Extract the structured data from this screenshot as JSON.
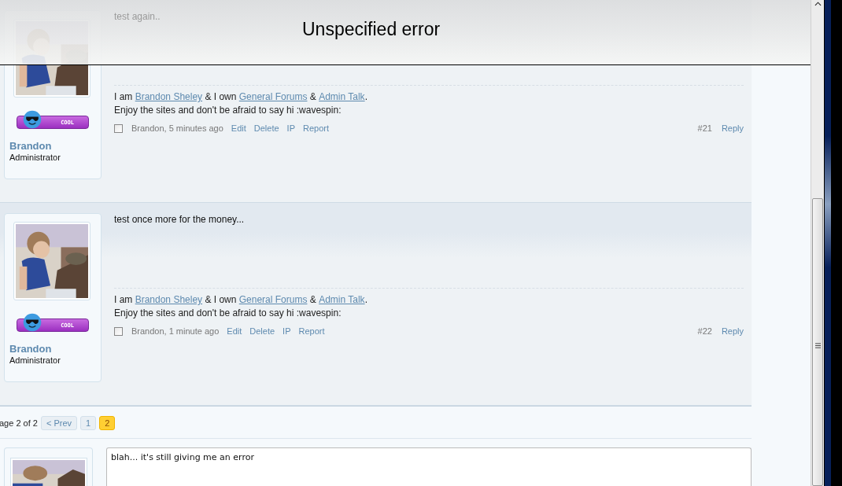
{
  "error_banner": {
    "title": "Unspecified error"
  },
  "posts": [
    {
      "message": "test again..",
      "author": "Brandon",
      "role": "Administrator",
      "badge": "COOL",
      "signature": [
        [
          {
            "kind": "text",
            "text": "I am "
          },
          {
            "kind": "link",
            "text": "Brandon Sheley"
          },
          {
            "kind": "text",
            "text": " & I own "
          },
          {
            "kind": "link",
            "text": "General Forums"
          },
          {
            "kind": "text",
            "text": " & "
          },
          {
            "kind": "link",
            "text": "Admin Talk"
          },
          {
            "kind": "text",
            "text": "."
          }
        ],
        [
          {
            "kind": "text",
            "text": "Enjoy the sites and don't be afraid to say hi :wavespin:"
          }
        ]
      ],
      "meta": "Brandon, 5 minutes ago",
      "actions": [
        "Edit",
        "Delete",
        "IP",
        "Report"
      ],
      "checked": false,
      "number": "#21",
      "reply": "Reply"
    },
    {
      "message": "test once more for the money...",
      "author": "Brandon",
      "role": "Administrator",
      "badge": "COOL",
      "signature": [
        [
          {
            "kind": "text",
            "text": "I am "
          },
          {
            "kind": "link",
            "text": "Brandon Sheley"
          },
          {
            "kind": "text",
            "text": " & I own "
          },
          {
            "kind": "link",
            "text": "General Forums"
          },
          {
            "kind": "text",
            "text": " & "
          },
          {
            "kind": "link",
            "text": "Admin Talk"
          },
          {
            "kind": "text",
            "text": "."
          }
        ],
        [
          {
            "kind": "text",
            "text": "Enjoy the sites and don't be afraid to say hi :wavespin:"
          }
        ]
      ],
      "meta": "Brandon, 1 minute ago",
      "actions": [
        "Edit",
        "Delete",
        "IP",
        "Report"
      ],
      "checked": false,
      "number": "#22",
      "reply": "Reply"
    }
  ],
  "pagination": {
    "label": "age 2 of 2",
    "prev": "< Prev",
    "pages": [
      {
        "label": "1",
        "selected": false
      },
      {
        "label": "2",
        "selected": true
      }
    ]
  },
  "quick_reply": {
    "value": "blah... it's still giving me an error"
  }
}
